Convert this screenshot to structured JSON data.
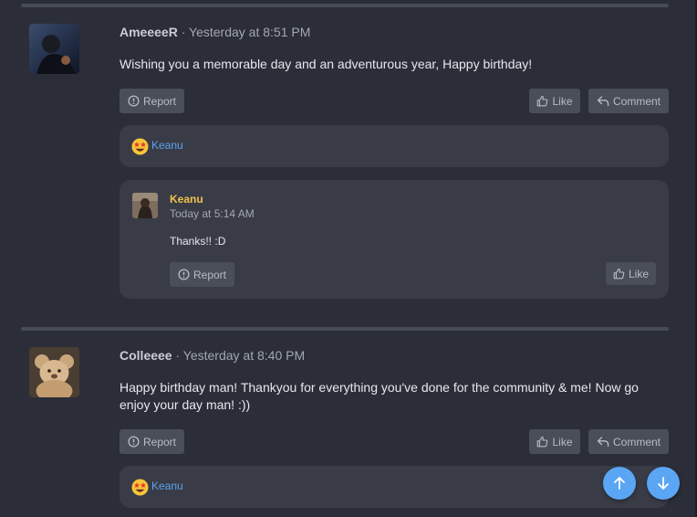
{
  "posts": [
    {
      "username": "AmeeeeR",
      "separator": "·",
      "timestamp": "Yesterday at 8:51 PM",
      "message": "Wishing you a memorable day and an adventurous year, Happy birthday!",
      "actions": {
        "report": "Report",
        "like": "Like",
        "comment": "Comment"
      },
      "reaction": {
        "emoji": "star-struck-emoji",
        "user": "Keanu"
      },
      "reply": {
        "username": "Keanu",
        "timestamp": "Today at 5:14 AM",
        "message": "Thanks!! :D",
        "actions": {
          "report": "Report",
          "like": "Like"
        }
      }
    },
    {
      "username": "Colleeee",
      "separator": "·",
      "timestamp": "Yesterday at 8:40 PM",
      "message_lines": [
        "Happy birthday man! Thankyou for everything you've done for the community & me! Now go",
        "enjoy your day man! :))"
      ],
      "actions": {
        "report": "Report",
        "like": "Like",
        "comment": "Comment"
      },
      "reaction": {
        "emoji": "star-struck-emoji",
        "user": "Keanu"
      }
    }
  ],
  "scroll_buttons": {
    "up_icon": "arrow-up-icon",
    "down_icon": "arrow-down-icon"
  },
  "colors": {
    "background": "#2b2e38",
    "panel": "#393c47",
    "accent": "#5aa6f4",
    "reply_name": "#f0c24a",
    "link": "#5ba2ee"
  }
}
